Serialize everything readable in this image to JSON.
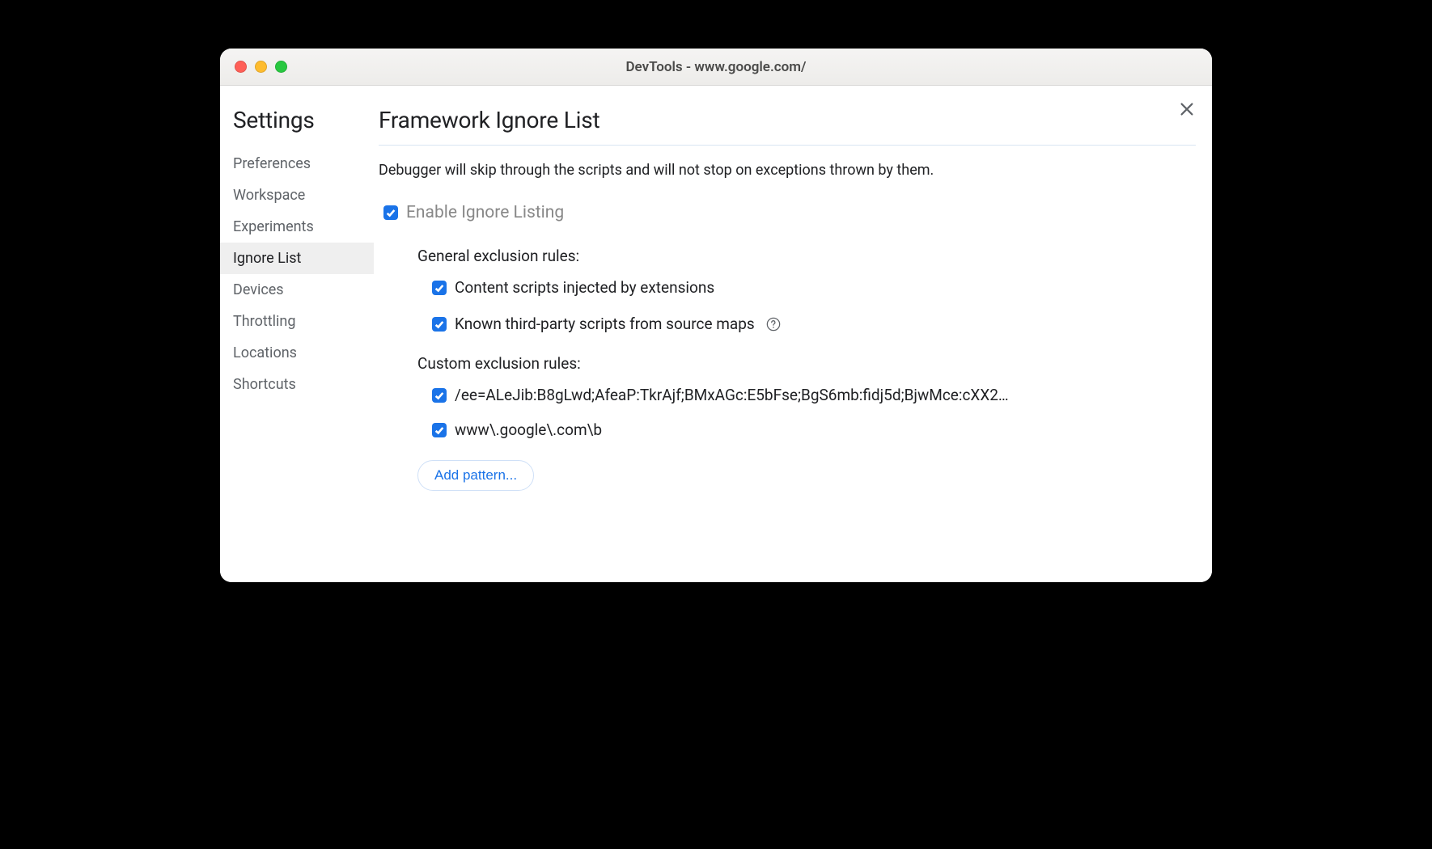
{
  "window": {
    "title": "DevTools - www.google.com/"
  },
  "sidebar": {
    "title": "Settings",
    "items": [
      {
        "label": "Preferences",
        "active": false
      },
      {
        "label": "Workspace",
        "active": false
      },
      {
        "label": "Experiments",
        "active": false
      },
      {
        "label": "Ignore List",
        "active": true
      },
      {
        "label": "Devices",
        "active": false
      },
      {
        "label": "Throttling",
        "active": false
      },
      {
        "label": "Locations",
        "active": false
      },
      {
        "label": "Shortcuts",
        "active": false
      }
    ]
  },
  "main": {
    "title": "Framework Ignore List",
    "description": "Debugger will skip through the scripts and will not stop on exceptions thrown by them.",
    "enable_label": "Enable Ignore Listing",
    "general_heading": "General exclusion rules:",
    "general_rules": [
      {
        "label": "Content scripts injected by extensions",
        "help": false
      },
      {
        "label": "Known third-party scripts from source maps",
        "help": true
      }
    ],
    "custom_heading": "Custom exclusion rules:",
    "custom_rules": [
      {
        "label": "/ee=ALeJib:B8gLwd;AfeaP:TkrAjf;BMxAGc:E5bFse;BgS6mb:fidj5d;BjwMce:cXX2…"
      },
      {
        "label": "www\\.google\\.com\\b"
      }
    ],
    "add_pattern_label": "Add pattern..."
  }
}
